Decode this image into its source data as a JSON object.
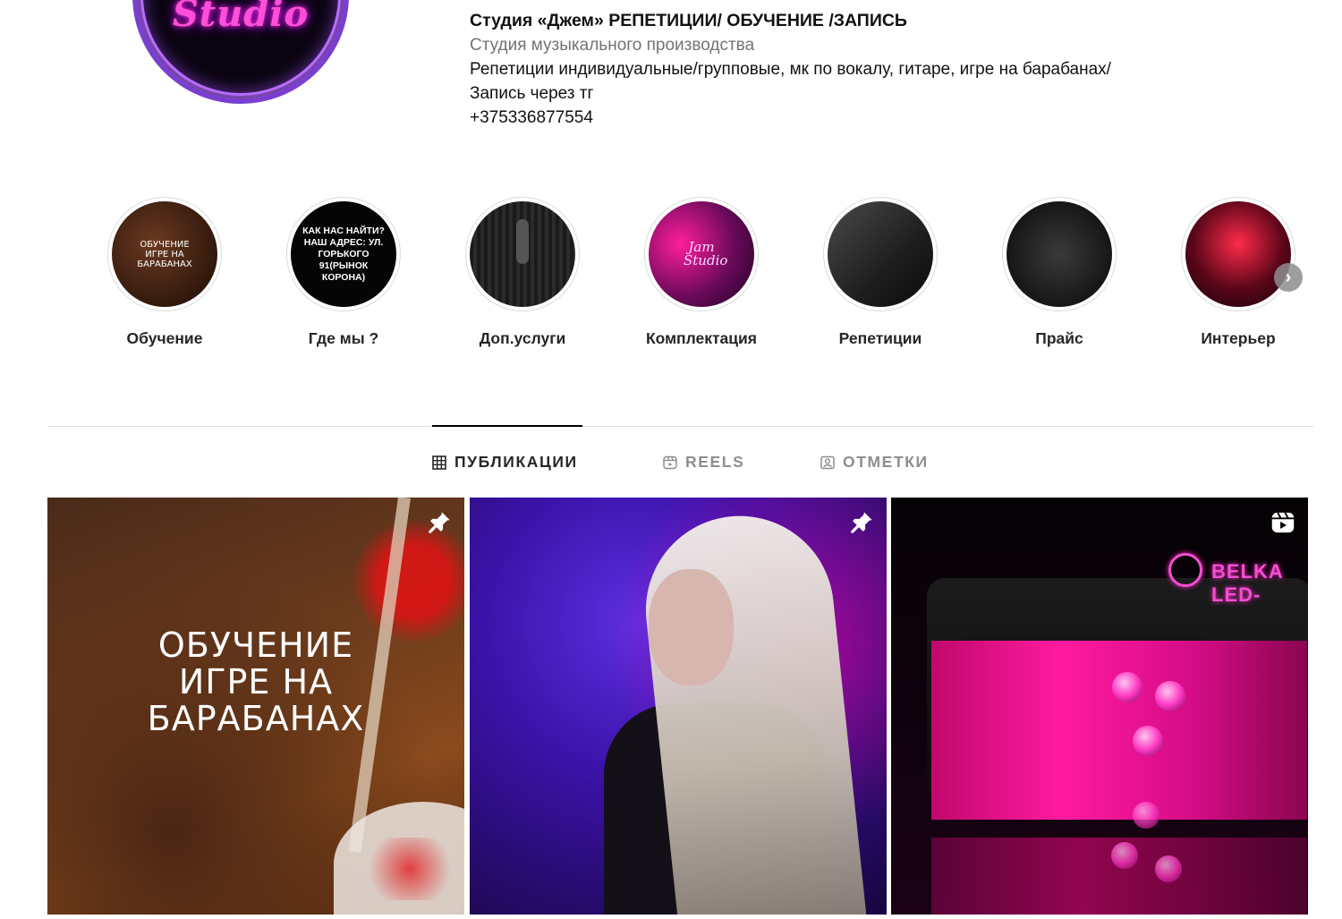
{
  "profile": {
    "avatar_text": "Studio",
    "name": "Студия «Джем» РЕПЕТИЦИИ/ ОБУЧЕНИЕ /ЗАПИСЬ",
    "category": "Студия музыкального производства",
    "bio_line1": "Репетиции индивидуальные/групповые, мк по вокалу, гитаре, игре на барабанах/",
    "bio_line2": "Запись через тг",
    "phone": "+375336877554"
  },
  "highlights": [
    {
      "label": "Обучение",
      "thumb_text": "ОБУЧЕНИЕ ИГРЕ НА БАРАБАНАХ"
    },
    {
      "label": "Где мы ?",
      "thumb_text": "КАК НАС НАЙТИ? НАШ АДРЕС: УЛ. ГОРЬКОГО 91(РЫНОК КОРОНА)"
    },
    {
      "label": "Доп.услуги",
      "thumb_text": ""
    },
    {
      "label": "Комплектация",
      "thumb_text": "Jam Studio"
    },
    {
      "label": "Репетиции",
      "thumb_text": ""
    },
    {
      "label": "Прайс",
      "thumb_text": ""
    },
    {
      "label": "Интерьер",
      "thumb_text": ""
    }
  ],
  "tabs": [
    {
      "label": "ПУБЛИКАЦИИ",
      "icon": "grid-icon",
      "active": true
    },
    {
      "label": "REELS",
      "icon": "reels-icon",
      "active": false
    },
    {
      "label": "ОТМЕТКИ",
      "icon": "tagged-icon",
      "active": false
    }
  ],
  "posts": [
    {
      "overlay_text": "ОБУЧЕНИЕ ИГРЕ НА БАРАБАНАХ",
      "badge": "pin-icon"
    },
    {
      "overlay_text": "",
      "badge": "pin-icon"
    },
    {
      "overlay_text": "",
      "badge": "reels-icon",
      "brand_text": "BELKA LED-"
    }
  ]
}
